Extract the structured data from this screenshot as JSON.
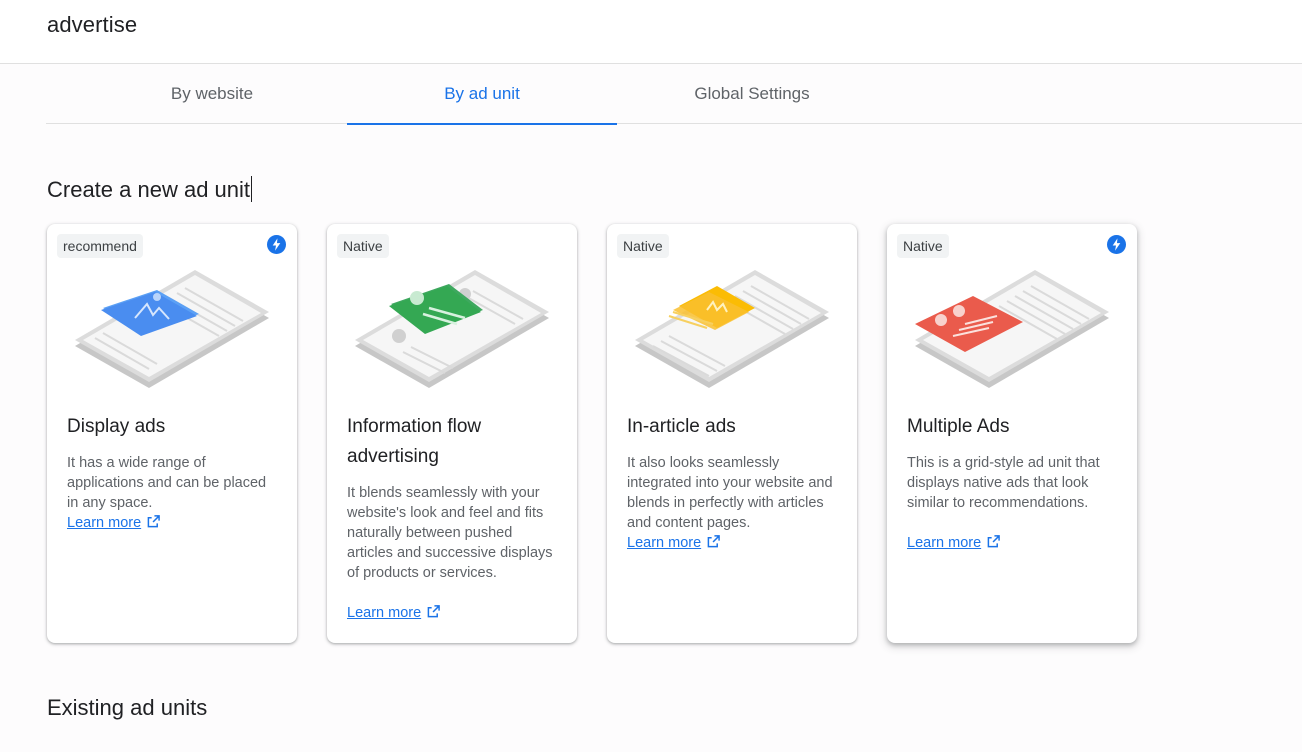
{
  "app": {
    "title": "advertise"
  },
  "tabs": [
    {
      "label": "By website"
    },
    {
      "label": "By ad unit"
    },
    {
      "label": "Global Settings"
    }
  ],
  "create_section": {
    "title": "Create a new ad unit"
  },
  "cards": [
    {
      "badge": "recommend",
      "title": "Display ads",
      "description": "It has a wide range of applications and can be placed in any space.",
      "link": "Learn more",
      "accent": "#4a8df0",
      "has_bolt_icon": true
    },
    {
      "badge": "Native",
      "title": "Information flow advertising",
      "description": "It blends seamlessly with your website's look and feel and fits naturally between pushed articles and successive displays of products or services.",
      "link": "Learn more",
      "accent": "#34a853",
      "has_bolt_icon": false
    },
    {
      "badge": "Native",
      "title": "In-article ads",
      "description": "It also looks seamlessly integrated into your website and blends in perfectly with articles and content pages.",
      "link": "Learn more",
      "accent": "#fbbc04",
      "has_bolt_icon": false
    },
    {
      "badge": "Native",
      "title": "Multiple Ads",
      "description": "This is a grid-style ad unit that displays native ads that look similar to recommendations.",
      "link": "Learn more",
      "accent": "#ea5b4c",
      "has_bolt_icon": true
    }
  ],
  "existing_section": {
    "title": "Existing ad units"
  },
  "colors": {
    "primary": "#1a73e8",
    "text": "#202124",
    "secondary_text": "#5f6368",
    "chip_bg": "#f1f3f4"
  }
}
